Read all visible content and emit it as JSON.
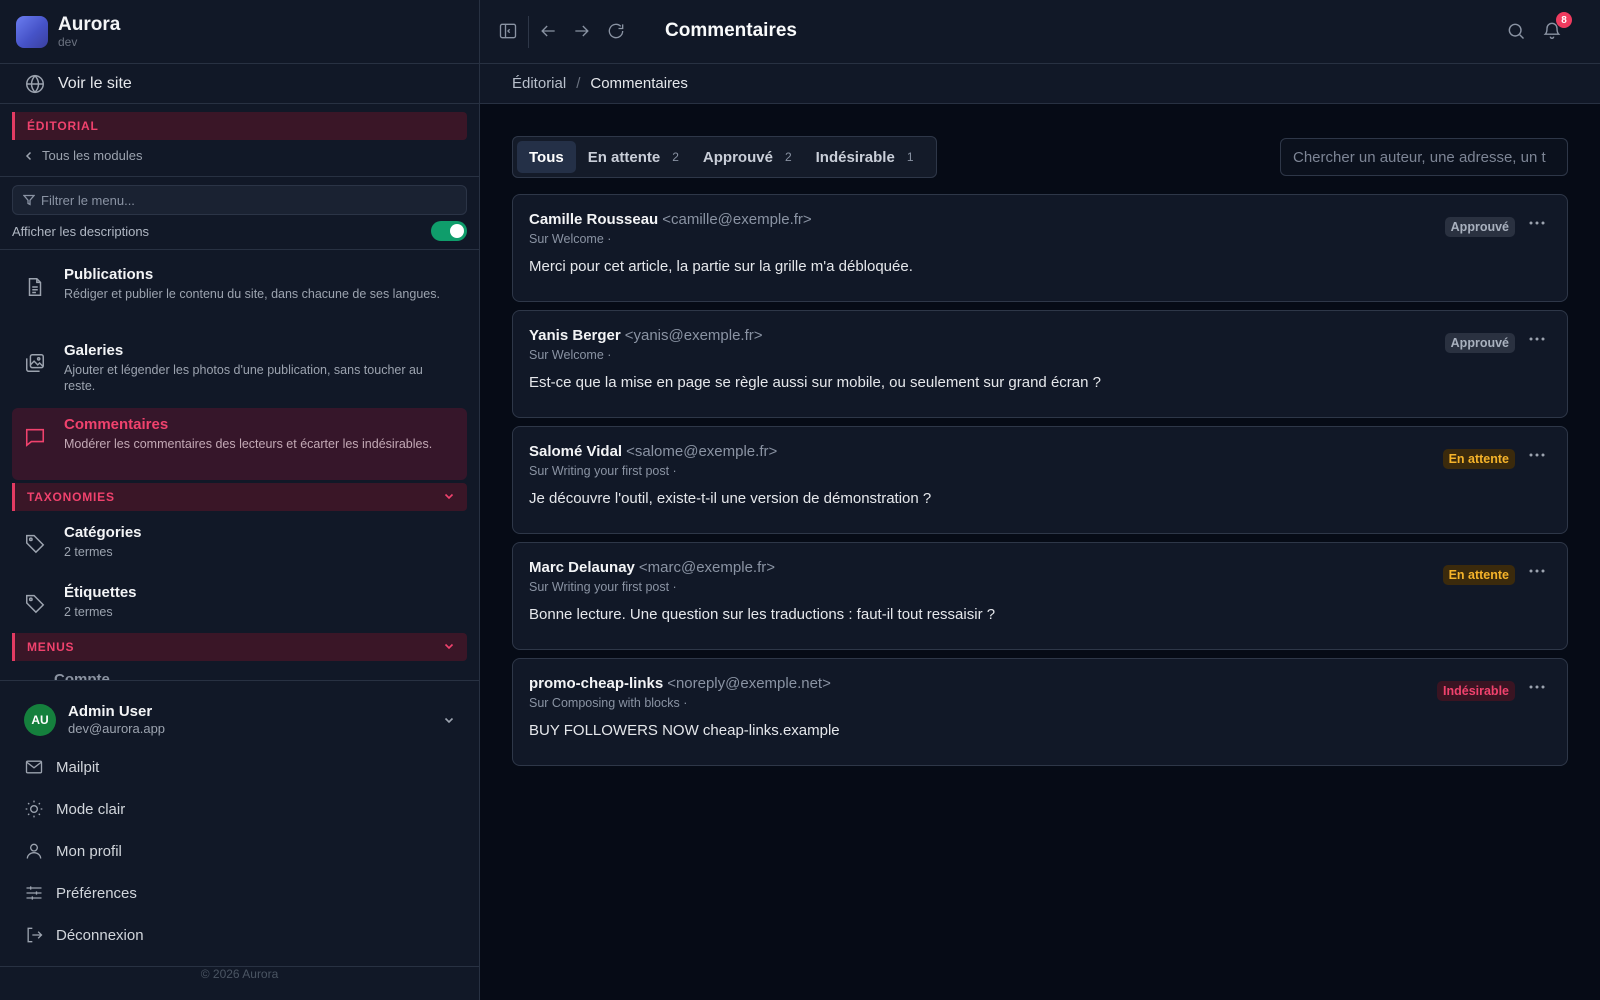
{
  "brand": {
    "name": "Aurora",
    "env": "dev"
  },
  "sidebar": {
    "view_site": "Voir le site",
    "section_editorial": "ÉDITORIAL",
    "back_link": "Tous les modules",
    "filter_placeholder": "Filtrer le menu...",
    "toggle_label": "Afficher les descriptions",
    "items": [
      {
        "title": "Publications",
        "desc": "Rédiger et publier le contenu du site, dans chacune de ses langues.",
        "icon": "document-icon"
      },
      {
        "title": "Galeries",
        "desc": "Ajouter et légender les photos d'une publication, sans toucher au reste.",
        "icon": "gallery-icon"
      },
      {
        "title": "Commentaires",
        "desc": "Modérer les commentaires des lecteurs et écarter les indésirables.",
        "icon": "comment-icon"
      }
    ],
    "section_taxonomies": "TAXONOMIES",
    "taxonomies": [
      {
        "title": "Catégories",
        "desc": "2 termes",
        "icon": "tag-icon"
      },
      {
        "title": "Étiquettes",
        "desc": "2 termes",
        "icon": "tag-icon"
      }
    ],
    "section_menus": "MENUS",
    "peek_item": "Compte",
    "user": {
      "initials": "AU",
      "name": "Admin User",
      "email": "dev@aurora.app"
    },
    "footer_items": [
      {
        "label": "Mailpit",
        "icon": "mail-icon"
      },
      {
        "label": "Mode clair",
        "icon": "sun-icon"
      },
      {
        "label": "Mon profil",
        "icon": "user-icon"
      },
      {
        "label": "Préférences",
        "icon": "sliders-icon"
      },
      {
        "label": "Déconnexion",
        "icon": "logout-icon"
      }
    ],
    "copyright": "© 2026 Aurora"
  },
  "topbar": {
    "title": "Commentaires",
    "notification_count": "8"
  },
  "breadcrumb": {
    "parent": "Éditorial",
    "separator": "/",
    "current": "Commentaires"
  },
  "tabs": [
    {
      "label": "Tous",
      "count": ""
    },
    {
      "label": "En attente",
      "count": "2"
    },
    {
      "label": "Approuvé",
      "count": "2"
    },
    {
      "label": "Indésirable",
      "count": "1"
    }
  ],
  "search": {
    "placeholder": "Chercher un auteur, une adresse, un t"
  },
  "comments": [
    {
      "author": "Camille Rousseau",
      "email": "<camille@exemple.fr>",
      "post": "Sur Welcome ·",
      "body": "Merci pour cet article, la partie sur la grille m'a débloquée.",
      "status": "Approuvé"
    },
    {
      "author": "Yanis Berger",
      "email": "<yanis@exemple.fr>",
      "post": "Sur Welcome ·",
      "body": "Est-ce que la mise en page se règle aussi sur mobile, ou seulement sur grand écran ?",
      "status": "Approuvé"
    },
    {
      "author": "Salomé Vidal",
      "email": "<salome@exemple.fr>",
      "post": "Sur Writing your first post ·",
      "body": "Je découvre l'outil, existe-t-il une version de démonstration ?",
      "status": "En attente"
    },
    {
      "author": "Marc Delaunay",
      "email": "<marc@exemple.fr>",
      "post": "Sur Writing your first post ·",
      "body": "Bonne lecture. Une question sur les traductions : faut-il tout ressaisir ?",
      "status": "En attente"
    },
    {
      "author": "promo-cheap-links",
      "email": "<noreply@exemple.net>",
      "post": "Sur Composing with blocks ·",
      "body": "BUY FOLLOWERS NOW cheap-links.example",
      "status": "Indésirable"
    }
  ],
  "colors": {
    "accent": "#f0426d",
    "success": "#0f9d6b",
    "warning": "#f5b32a"
  }
}
